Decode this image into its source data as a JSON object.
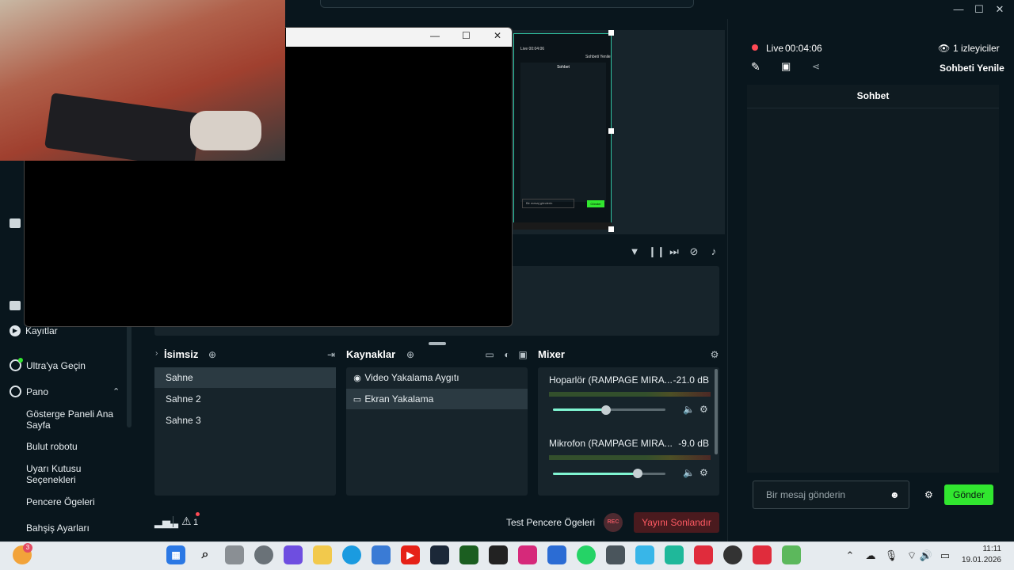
{
  "window": {
    "minimize": "—",
    "maximize": "☐",
    "close": "✕",
    "collapse_chevron": "›"
  },
  "sidebar": {
    "recordings": "Kayıtlar",
    "ultra": "Ultra'ya Geçin",
    "dashboard": "Pano",
    "sub_items": [
      "Gösterge Paneli Ana Sayfa",
      "Bulut robotu",
      "Uyarı Kutusu Seçenekleri",
      "Pencere Ögeleri",
      "Bahşiş Ayarları"
    ]
  },
  "scenes": {
    "title": "İsimsiz",
    "items": [
      "Sahne",
      "Sahne 2",
      "Sahne 3"
    ]
  },
  "sources": {
    "title": "Kaynaklar",
    "items": [
      "Video Yakalama Aygıtı",
      "Ekran Yakalama"
    ]
  },
  "mixer": {
    "title": "Mixer",
    "channels": [
      {
        "name": "Hoparlör (RAMPAGE MIRA...",
        "db": "-21.0 dB",
        "level": 0.47
      },
      {
        "name": "Mikrofon (RAMPAGE MIRA...",
        "db": "-9.0 dB",
        "level": 0.75
      }
    ]
  },
  "statusbar": {
    "alert_count": "1",
    "test_widgets": "Test Pencere Ögeleri",
    "rec": "REC",
    "end_stream": "Yayını Sonlandır"
  },
  "chat": {
    "live_label": "Live",
    "live_time": "00:04:06",
    "viewers": "1 izleyiciler",
    "refresh": "Sohbeti Yenile",
    "header": "Sohbet",
    "input_placeholder": "Bir mesaj gönderin",
    "send": "Gönder"
  },
  "preview_mini": {
    "live": "Live 00:04:06",
    "refresh": "Sohbeti Yenile",
    "header": "Sohbet",
    "input": "Bir mesaj gönderin",
    "send": "Gönder"
  },
  "taskbar": {
    "notification_badge": "3",
    "time": "11:11",
    "date": "19.01.2026"
  },
  "colors": {
    "accent_green": "#31e62f",
    "teal": "#80f5d2",
    "end_stream_red": "#ff5a63",
    "background": "#09161d",
    "panel": "#17242b"
  }
}
